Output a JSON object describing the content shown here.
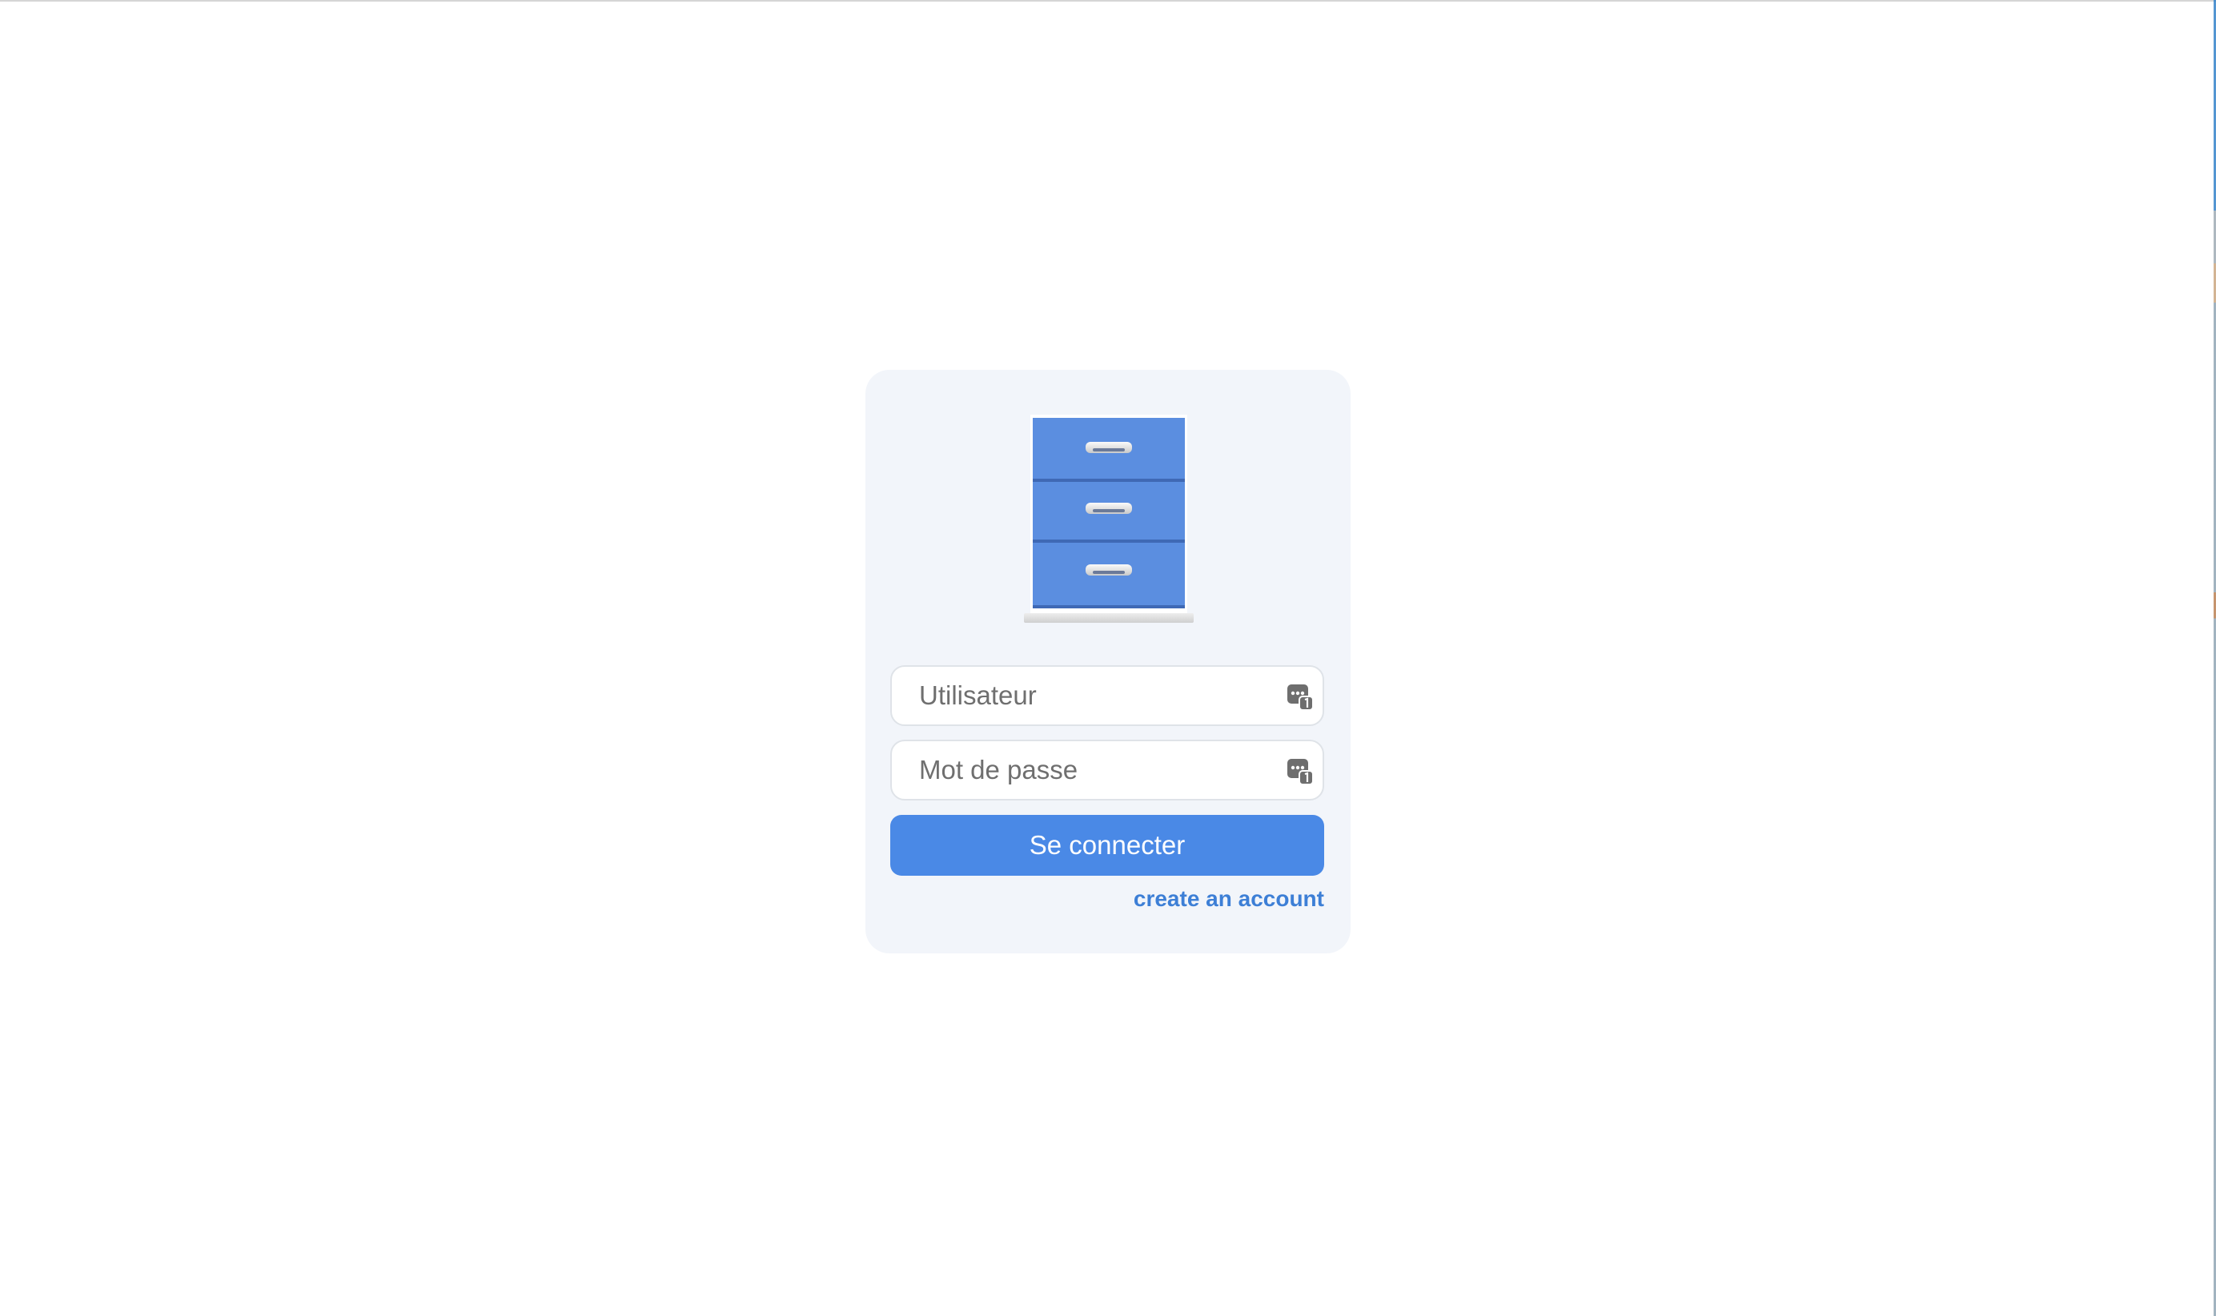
{
  "login": {
    "logo_icon": "filing-cabinet-icon",
    "username": {
      "placeholder": "Utilisateur",
      "value": "",
      "icon": "password-manager-key-icon"
    },
    "password": {
      "placeholder": "Mot de passe",
      "value": "",
      "icon": "password-manager-key-icon"
    },
    "submit_label": "Se connecter",
    "create_account_label": "create an account"
  },
  "colors": {
    "page_background": "#ffffff",
    "card_background": "#f2f5fa",
    "accent": "#4a89e6",
    "link": "#3d7fd6",
    "cabinet_blue": "#5b8ee0"
  }
}
